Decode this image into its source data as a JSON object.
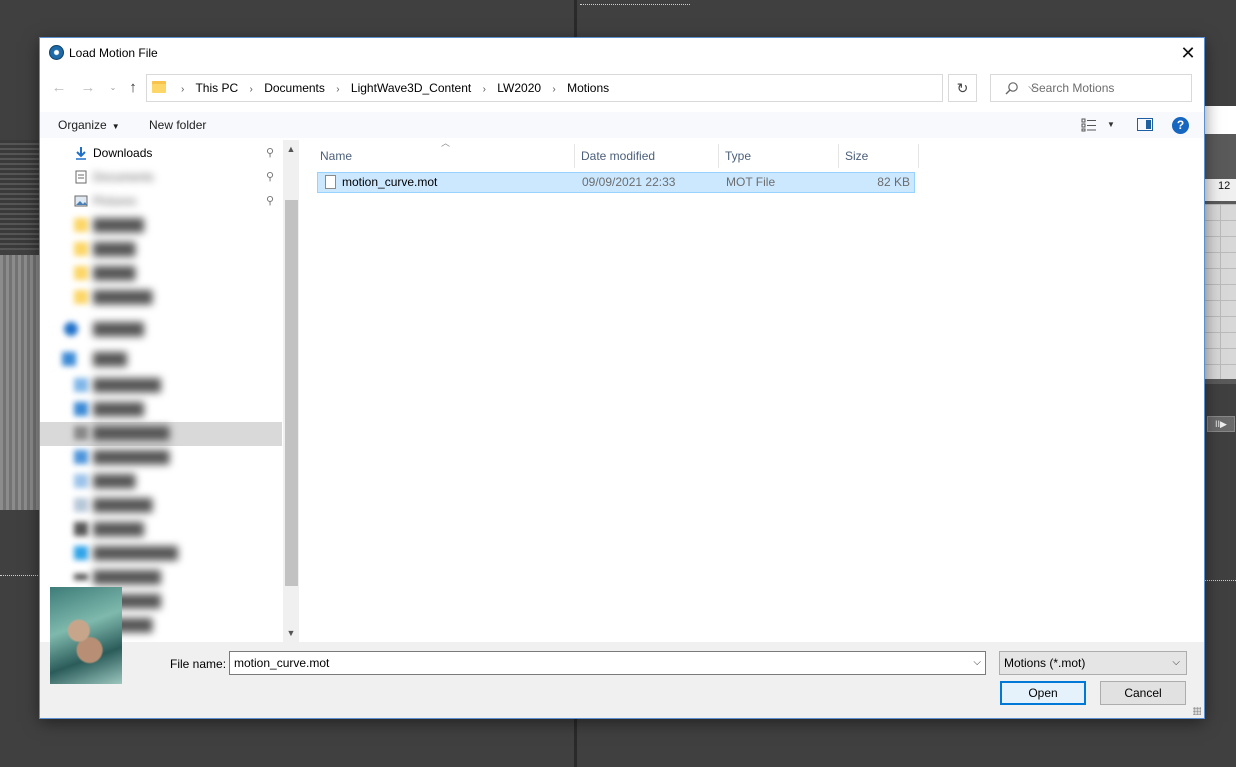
{
  "dialog": {
    "title": "Load Motion File",
    "close_glyph": "✕"
  },
  "nav": {
    "back_glyph": "←",
    "forward_glyph": "→",
    "recent_glyph": "⌄",
    "up_glyph": "↑",
    "breadcrumbs": [
      "This PC",
      "Documents",
      "LightWave3D_Content",
      "LW2020",
      "Motions"
    ],
    "refresh_glyph": "↻",
    "search_placeholder": "Search Motions"
  },
  "toolbar": {
    "organize_label": "Organize",
    "new_folder_label": "New folder",
    "help_glyph": "?"
  },
  "sidebar": {
    "items": [
      {
        "label": "Downloads",
        "icon": "download-arrow-icon",
        "pinned": true
      },
      {
        "label": "Documents",
        "icon": "document-icon",
        "pinned": true
      },
      {
        "label": "Pictures",
        "icon": "pictures-icon",
        "pinned": true
      },
      {
        "label": "",
        "icon": "folder-icon",
        "pinned": false
      },
      {
        "label": "",
        "icon": "folder-icon",
        "pinned": false
      },
      {
        "label": "",
        "icon": "folder-icon",
        "pinned": false
      },
      {
        "label": "",
        "icon": "folder-icon",
        "pinned": false
      },
      {
        "label": "",
        "icon": "cloud-icon",
        "pinned": false
      },
      {
        "label": "",
        "icon": "computer-icon",
        "pinned": false
      },
      {
        "label": "",
        "icon": "3d-objects-icon",
        "pinned": false
      },
      {
        "label": "",
        "icon": "desktop-icon",
        "pinned": false
      },
      {
        "label": "",
        "icon": "documents-icon",
        "pinned": false
      },
      {
        "label": "",
        "icon": "downloads-icon",
        "pinned": false
      },
      {
        "label": "",
        "icon": "music-icon",
        "pinned": false
      },
      {
        "label": "",
        "icon": "pictures-icon",
        "pinned": false
      },
      {
        "label": "",
        "icon": "videos-icon",
        "pinned": false
      },
      {
        "label": "",
        "icon": "windows-drive-icon",
        "pinned": false
      },
      {
        "label": "",
        "icon": "drive-icon",
        "pinned": false
      },
      {
        "label": "",
        "icon": "drive-icon",
        "pinned": false
      },
      {
        "label": "",
        "icon": "network-icon",
        "pinned": false
      }
    ],
    "pin_glyph": "📌"
  },
  "filelist": {
    "columns": [
      "Name",
      "Date modified",
      "Type",
      "Size"
    ],
    "rows": [
      {
        "name": "motion_curve.mot",
        "date": "09/09/2021 22:33",
        "type": "MOT File",
        "size": "82 KB",
        "selected": true
      }
    ]
  },
  "footer": {
    "file_name_label": "File name:",
    "file_name_value": "motion_curve.mot",
    "filter_value": "Motions (*.mot)",
    "open_label": "Open",
    "cancel_label": "Cancel"
  },
  "background": {
    "timeline_number": "12",
    "play_glyph": "II▶"
  },
  "colors": {
    "selection_bg": "#cce8ff",
    "selection_border": "#99d1ff",
    "accent": "#0078d7",
    "help": "#1766c0"
  }
}
